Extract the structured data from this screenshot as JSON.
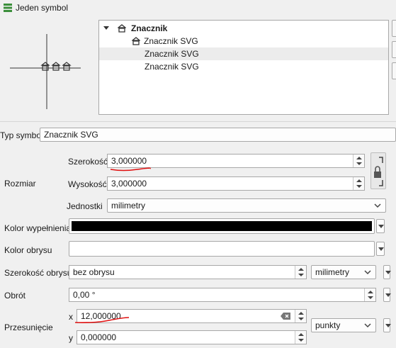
{
  "window": {
    "title": "Jeden symbol"
  },
  "tree": {
    "root_label": "Znacznik",
    "items": [
      {
        "label": "Znacznik SVG"
      },
      {
        "label": "Znacznik SVG"
      },
      {
        "label": "Znacznik SVG"
      }
    ]
  },
  "symbol_type": {
    "label": "Typ symbolu",
    "value": "Znacznik SVG"
  },
  "size": {
    "group_label": "Rozmiar",
    "width_label": "Szerokość",
    "width_value": "3,000000",
    "height_label": "Wysokość",
    "height_value": "3,000000",
    "units_label": "Jednostki",
    "units_value": "milimetry"
  },
  "fill_color": {
    "label": "Kolor wypełnienia",
    "color": "#000000"
  },
  "stroke_color": {
    "label": "Kolor obrysu",
    "color": "#ffffff"
  },
  "stroke_width": {
    "label": "Szerokość obrysu",
    "value": "bez obrysu",
    "units_value": "milimetry"
  },
  "rotation": {
    "label": "Obrót",
    "value": "0,00 °"
  },
  "offset": {
    "label": "Przesunięcie",
    "x_label": "x",
    "x_value": "12,000000",
    "y_label": "y",
    "y_value": "0,000000",
    "units_value": "punkty"
  },
  "colors": {
    "annotation": "#e01010"
  }
}
